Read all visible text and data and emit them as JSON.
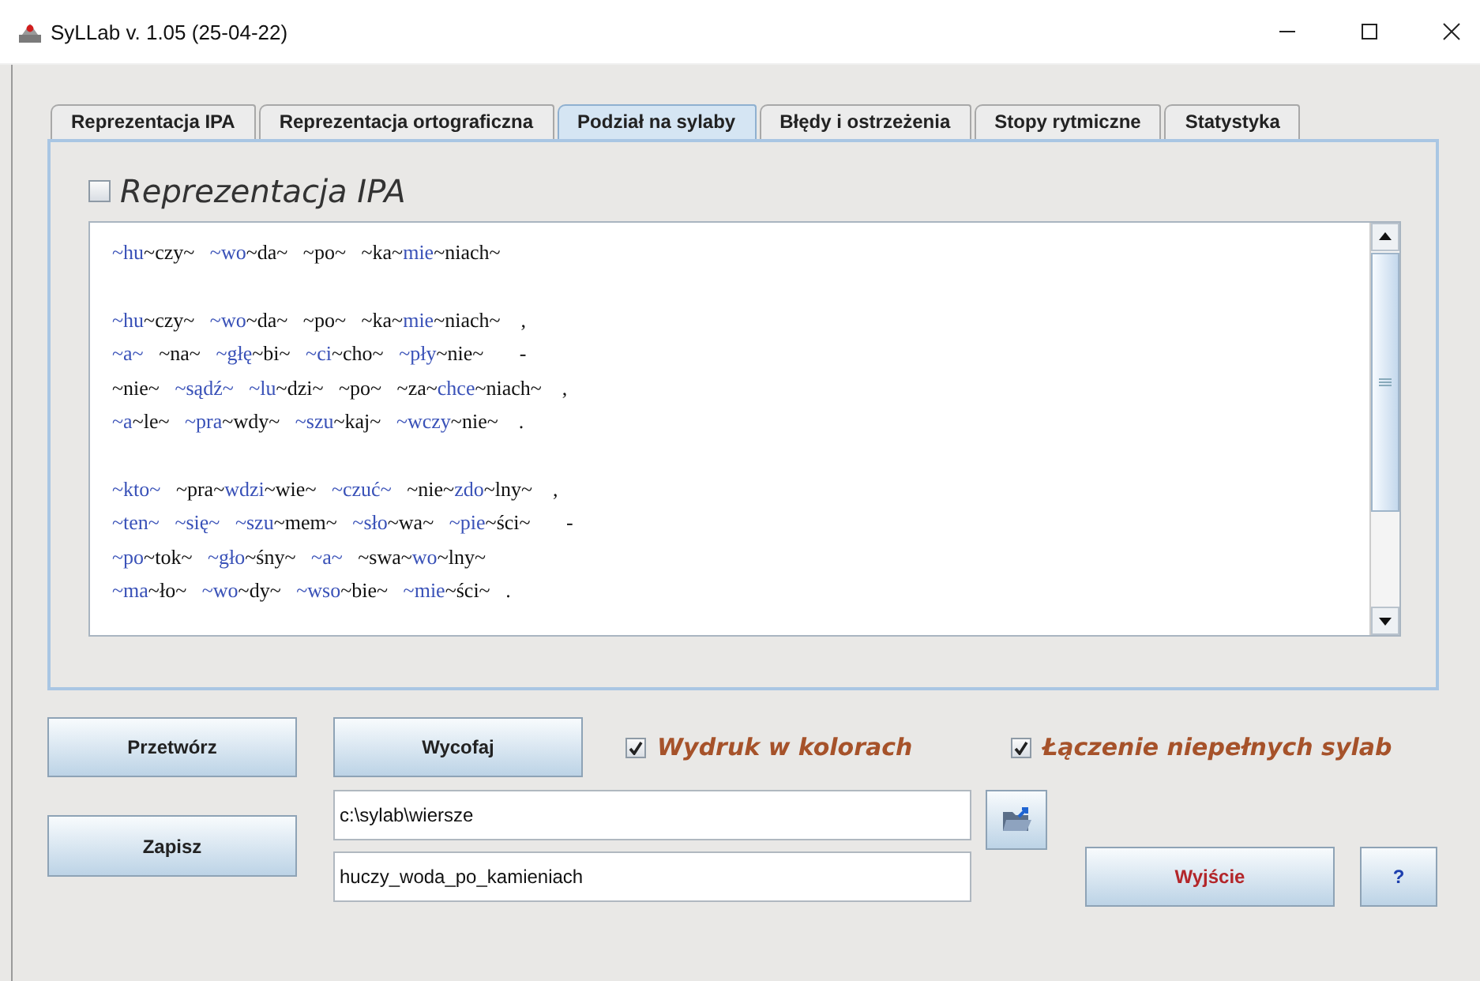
{
  "window": {
    "title": "SyLLab v. 1.05 (25-04-22)"
  },
  "tabs": [
    {
      "label": "Reprezentacja IPA",
      "selected": false
    },
    {
      "label": "Reprezentacja ortograficzna",
      "selected": false
    },
    {
      "label": "Podział na sylaby",
      "selected": true
    },
    {
      "label": "Błędy i ostrzeżenia",
      "selected": false
    },
    {
      "label": "Stopy rytmiczne",
      "selected": false
    },
    {
      "label": "Statystyka",
      "selected": false
    }
  ],
  "ipa_checkbox": {
    "label": "Reprezentacja IPA",
    "checked": false
  },
  "text_area": {
    "stanzas": [
      [
        [
          {
            "text": "~hu",
            "color": "#3a52b8"
          },
          {
            "text": "~czy~   ",
            "color": "#111111"
          },
          {
            "text": "~wo",
            "color": "#3a52b8"
          },
          {
            "text": "~da~   ~po~   ~ka~",
            "color": "#111111"
          },
          {
            "text": "mie",
            "color": "#3a52b8"
          },
          {
            "text": "~niach~",
            "color": "#111111"
          }
        ]
      ],
      [
        [
          {
            "text": "~hu",
            "color": "#3a52b8"
          },
          {
            "text": "~czy~   ",
            "color": "#111111"
          },
          {
            "text": "~wo",
            "color": "#3a52b8"
          },
          {
            "text": "~da~   ~po~   ~ka~",
            "color": "#111111"
          },
          {
            "text": "mie",
            "color": "#3a52b8"
          },
          {
            "text": "~niach~    ,",
            "color": "#111111"
          }
        ],
        [
          {
            "text": "~a~",
            "color": "#3a52b8"
          },
          {
            "text": "   ~na~   ",
            "color": "#111111"
          },
          {
            "text": "~głę",
            "color": "#3a52b8"
          },
          {
            "text": "~bi~   ",
            "color": "#111111"
          },
          {
            "text": "~ci",
            "color": "#3a52b8"
          },
          {
            "text": "~cho~   ",
            "color": "#111111"
          },
          {
            "text": "~pły",
            "color": "#3a52b8"
          },
          {
            "text": "~nie~       -",
            "color": "#111111"
          }
        ],
        [
          {
            "text": "~nie~   ",
            "color": "#111111"
          },
          {
            "text": "~sądź~   ",
            "color": "#3a52b8"
          },
          {
            "text": "~lu",
            "color": "#3a52b8"
          },
          {
            "text": "~dzi~   ~po~   ~za~",
            "color": "#111111"
          },
          {
            "text": "chce",
            "color": "#3a52b8"
          },
          {
            "text": "~niach~    ,",
            "color": "#111111"
          }
        ],
        [
          {
            "text": "~a",
            "color": "#3a52b8"
          },
          {
            "text": "~le~   ",
            "color": "#111111"
          },
          {
            "text": "~pra",
            "color": "#3a52b8"
          },
          {
            "text": "~wdy~   ",
            "color": "#111111"
          },
          {
            "text": "~szu",
            "color": "#3a52b8"
          },
          {
            "text": "~kaj~   ",
            "color": "#111111"
          },
          {
            "text": "~wczy",
            "color": "#3a52b8"
          },
          {
            "text": "~nie~    .",
            "color": "#111111"
          }
        ]
      ],
      [
        [
          {
            "text": "~kto~",
            "color": "#3a52b8"
          },
          {
            "text": "   ~pra~",
            "color": "#111111"
          },
          {
            "text": "wdzi",
            "color": "#3a52b8"
          },
          {
            "text": "~wie~   ",
            "color": "#111111"
          },
          {
            "text": "~czuć~",
            "color": "#3a52b8"
          },
          {
            "text": "   ~nie~",
            "color": "#111111"
          },
          {
            "text": "zdo",
            "color": "#3a52b8"
          },
          {
            "text": "~lny~    ,",
            "color": "#111111"
          }
        ],
        [
          {
            "text": "~ten~   ~się~   ",
            "color": "#3a52b8"
          },
          {
            "text": "~szu",
            "color": "#3a52b8"
          },
          {
            "text": "~mem~   ",
            "color": "#111111"
          },
          {
            "text": "~sło",
            "color": "#3a52b8"
          },
          {
            "text": "~wa~   ",
            "color": "#111111"
          },
          {
            "text": "~pie",
            "color": "#3a52b8"
          },
          {
            "text": "~ści~       -",
            "color": "#111111"
          }
        ],
        [
          {
            "text": "~po",
            "color": "#3a52b8"
          },
          {
            "text": "~tok~   ",
            "color": "#111111"
          },
          {
            "text": "~gło",
            "color": "#3a52b8"
          },
          {
            "text": "~śny~   ",
            "color": "#111111"
          },
          {
            "text": "~a~",
            "color": "#3a52b8"
          },
          {
            "text": "   ~swa~",
            "color": "#111111"
          },
          {
            "text": "wo",
            "color": "#3a52b8"
          },
          {
            "text": "~lny~",
            "color": "#111111"
          }
        ],
        [
          {
            "text": "~ma",
            "color": "#3a52b8"
          },
          {
            "text": "~ło~   ",
            "color": "#111111"
          },
          {
            "text": "~wo",
            "color": "#3a52b8"
          },
          {
            "text": "~dy~   ",
            "color": "#111111"
          },
          {
            "text": "~wso",
            "color": "#3a52b8"
          },
          {
            "text": "~bie~   ",
            "color": "#111111"
          },
          {
            "text": "~mie",
            "color": "#3a52b8"
          },
          {
            "text": "~ści~   .",
            "color": "#111111"
          }
        ]
      ]
    ]
  },
  "buttons": {
    "process": "Przetwórz",
    "undo": "Wycofaj",
    "save": "Zapisz",
    "exit": "Wyjście",
    "help": "?"
  },
  "options": [
    {
      "label": "Wydruk w kolorach",
      "checked": true
    },
    {
      "label": "Łączenie niepełnych sylab",
      "checked": true
    }
  ],
  "path_field": {
    "value": "c:\\sylab\\wiersze"
  },
  "file_field": {
    "value": "huczy_woda_po_kamieniach"
  }
}
